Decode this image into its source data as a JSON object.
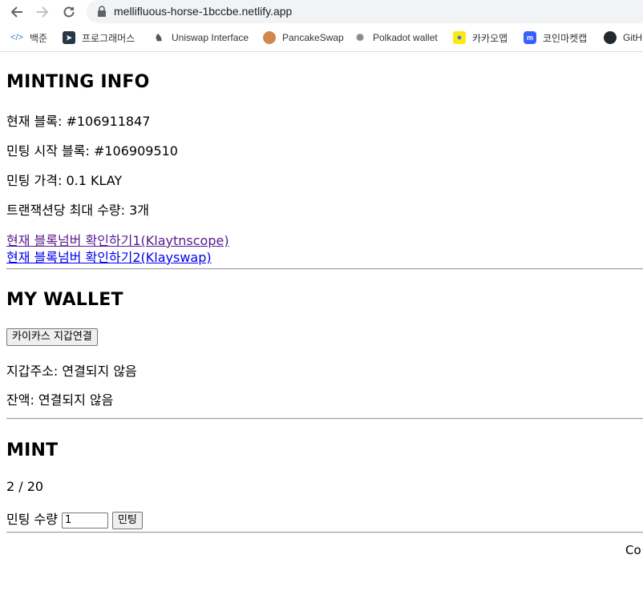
{
  "browser": {
    "url": "mellifluous-horse-1bccbe.netlify.app",
    "bookmarks": [
      {
        "label": "백준",
        "icon": "code-icon"
      },
      {
        "label": "프로그래머스",
        "icon": "programmers-icon"
      },
      {
        "label": "Uniswap Interface",
        "icon": "unicorn-icon"
      },
      {
        "label": "PancakeSwap",
        "icon": "bunny-icon"
      },
      {
        "label": "Polkadot wallet",
        "icon": "polkadot-icon"
      },
      {
        "label": "카카오맵",
        "icon": "map-pin-icon"
      },
      {
        "label": "코인마켓캡",
        "icon": "coinmarketcap-icon"
      },
      {
        "label": "GitH",
        "icon": "github-icon"
      }
    ]
  },
  "minting_info": {
    "title": "MINTING INFO",
    "current_block": "현재 블록: #106911847",
    "start_block": "민팅 시작 블록: #106909510",
    "price": "민팅 가격: 0.1 KLAY",
    "max_per_tx": "트랜잭션당 최대 수량: 3개",
    "link1": "현재 블록넘버 확인하기1(Klaytnscope)",
    "link2": "현재 블록넘버 확인하기2(Klayswap)"
  },
  "wallet": {
    "title": "MY WALLET",
    "connect_label": "카이카스 지갑연결",
    "address": "지갑주소: 연결되지 않음",
    "balance": "잔액: 연결되지 않음"
  },
  "mint": {
    "title": "MINT",
    "progress": "2 / 20",
    "progress_minted": 2,
    "progress_total": 20,
    "qty_label": "민팅 수량",
    "qty_value": "1",
    "mint_label": "민팅"
  },
  "footer": {
    "text": "Co"
  }
}
